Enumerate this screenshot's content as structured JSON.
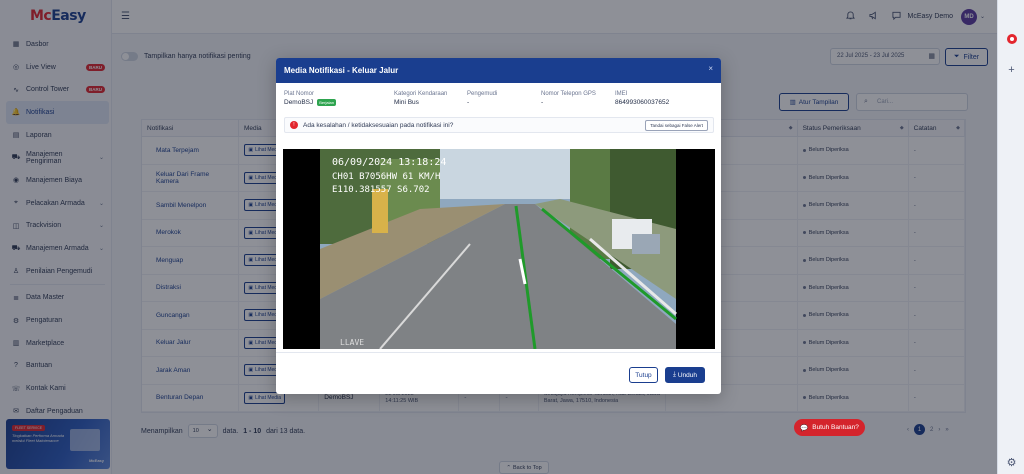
{
  "app": {
    "logo": {
      "mc": "Mc",
      "easy": "Easy"
    },
    "user_name": "McEasy Demo",
    "avatar_initials": "MD"
  },
  "sidebar": {
    "items": [
      {
        "label": "Dasbor",
        "icon": "grid-icon"
      },
      {
        "label": "Live View",
        "icon": "broadcast-icon",
        "badge": "BARU"
      },
      {
        "label": "Control Tower",
        "icon": "pulse-icon",
        "badge": "BARU"
      },
      {
        "label": "Notifikasi",
        "icon": "bell-icon",
        "active": true
      },
      {
        "label": "Laporan",
        "icon": "document-icon"
      },
      {
        "label": "Manajemen Pengiriman",
        "icon": "truck-icon",
        "chevron": true
      },
      {
        "label": "Manajemen Biaya",
        "icon": "money-icon"
      },
      {
        "label": "Pelacakan Armada",
        "icon": "map-icon",
        "chevron": true
      },
      {
        "label": "Trackvision",
        "icon": "camera-icon",
        "chevron": true
      },
      {
        "label": "Manajemen Armada",
        "icon": "fleet-icon",
        "chevron": true
      },
      {
        "label": "Penilaian Pengemudi",
        "icon": "driver-icon"
      },
      {
        "label": "Data Master",
        "icon": "database-icon"
      },
      {
        "label": "Pengaturan",
        "icon": "gear-icon"
      },
      {
        "label": "Marketplace",
        "icon": "store-icon"
      },
      {
        "label": "Bantuan",
        "icon": "help-icon"
      },
      {
        "label": "Kontak Kami",
        "icon": "phone-icon"
      },
      {
        "label": "Daftar Pengaduan",
        "icon": "complaint-icon"
      }
    ],
    "promo": {
      "tag": "FLEET SERVICE",
      "text": "Tingkatkan Performa Armada melalui Fleet Maintenance",
      "brand": "McEasy"
    }
  },
  "toolbar": {
    "toggle_label": "Tampilkan hanya notifikasi penting",
    "date_range": "22 Jul 2025 - 23 Jul 2025",
    "filter_label": "Filter",
    "atur_label": "Atur Tampilan",
    "search_placeholder": "Cari..."
  },
  "table": {
    "headers": [
      "Notifikasi",
      "Media",
      "",
      "",
      "",
      "",
      "",
      "",
      "Status Pemeriksaan",
      "Catatan"
    ],
    "rows": [
      {
        "notif": "Mata Terpejam",
        "media": "Lihat Media",
        "status": "Belum Diperiksa",
        "note": "-"
      },
      {
        "notif": "Keluar Dari Frame Kamera",
        "media": "Lihat Media",
        "status": "Belum Diperiksa",
        "note": "-"
      },
      {
        "notif": "Sambil Menelpon",
        "media": "Lihat Media",
        "status": "Belum Diperiksa",
        "note": "-"
      },
      {
        "notif": "Merokok",
        "media": "Lihat Media",
        "status": "Belum Diperiksa",
        "note": "-"
      },
      {
        "notif": "Menguap",
        "media": "Lihat Media",
        "status": "Belum Diperiksa",
        "note": "-"
      },
      {
        "notif": "Distraksi",
        "media": "Lihat Media",
        "status": "Belum Diperiksa",
        "note": "-"
      },
      {
        "notif": "Guncangan",
        "media": "Lihat Media",
        "status": "Belum Diperiksa",
        "note": "-"
      },
      {
        "notif": "Keluar Jalur",
        "media": "Lihat Media",
        "status": "Belum Diperiksa",
        "note": "-"
      },
      {
        "notif": "Jarak Aman",
        "media": "Lihat Media",
        "status": "Belum Diperiksa",
        "note": "-"
      },
      {
        "notif": "Benturan Depan",
        "media": "Lihat Media",
        "plate": "DemoBSJ",
        "date": "22 Jul 2025",
        "time": "14:11:25 WIB",
        "driver": "-",
        "phone": "-",
        "address": "Setiajaya Kompleks Tambun, Kab Bekasi, Jawa Barat, Jawa, 17510, Indonesia",
        "status": "Belum Diperiksa",
        "note": "-"
      }
    ]
  },
  "pagination": {
    "show_label": "Menampilkan",
    "per_page": "10",
    "summary_prefix": "data.",
    "summary_range": "1 - 10",
    "summary_suffix": "dari 13 data.",
    "prev": "‹",
    "pages": [
      "1",
      "2"
    ],
    "next": "›",
    "last": "»"
  },
  "back_to_top": "Back to Top",
  "help_button": "Butuh Bantuan?",
  "modal": {
    "title": "Media Notifikasi - Keluar Jalur",
    "close": "×",
    "fields": [
      {
        "label": "Plat Nomor",
        "value": "DemoBSJ",
        "badge": "Berjalan"
      },
      {
        "label": "Kategori Kendaraan",
        "value": "Mini Bus"
      },
      {
        "label": "Pengemudi",
        "value": "-"
      },
      {
        "label": "Nomor Telepon GPS",
        "value": "-"
      },
      {
        "label": "IMEI",
        "value": "864993060037652"
      }
    ],
    "alert_text": "Ada kesalahan / ketidaksesuaian pada notifikasi ini?",
    "false_alert_label": "Tandai sebagai False Alert",
    "video_overlay": {
      "line1": "06/09/2024 13:18:24",
      "line2": "CH01 B7056HW 61 KM/H",
      "line3": "E110.381557 S6.702",
      "footer": "LLAVE"
    },
    "close_button": "Tutup",
    "download_button": "Unduh"
  },
  "colors": {
    "brand_blue": "#1a3e8f",
    "brand_red": "#e3262e",
    "lane_green": "#1f9a2a"
  }
}
